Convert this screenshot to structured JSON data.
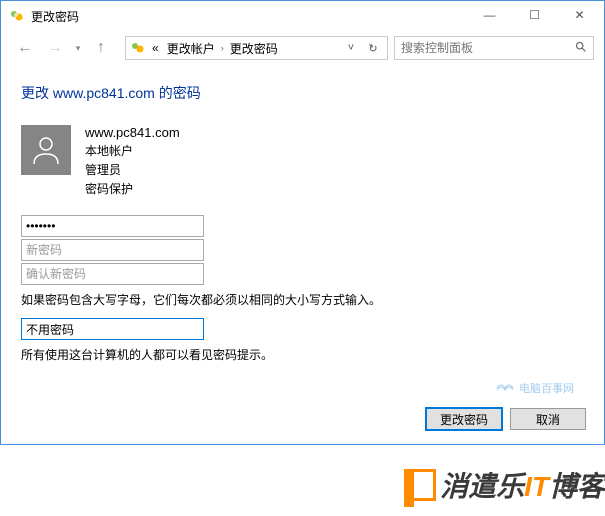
{
  "window": {
    "title": "更改密码",
    "minimize": "—",
    "maximize": "☐",
    "close": "✕"
  },
  "nav": {
    "back": "←",
    "forward": "→",
    "dropdown": "▾",
    "up": "↑",
    "refresh": "↻",
    "addr_dropdown": "˅",
    "breadcrumb": [
      "更改帐户",
      "更改密码"
    ],
    "crumb_prefix": "«",
    "search_placeholder": "搜索控制面板"
  },
  "page": {
    "title": "更改 www.pc841.com 的密码"
  },
  "user": {
    "name": "www.pc841.com",
    "type": "本地帐户",
    "role": "管理员",
    "protection": "密码保护"
  },
  "fields": {
    "current_value": "•••••••",
    "new_placeholder": "新密码",
    "confirm_placeholder": "确认新密码",
    "hint_value": "不用密码"
  },
  "help": {
    "text1": "如果密码包含大写字母，它们每次都必须以相同的大小写方式输入。",
    "text2": "所有使用这台计算机的人都可以看见密码提示。"
  },
  "buttons": {
    "submit": "更改密码",
    "cancel": "取消"
  },
  "watermark": {
    "text": "电脑百事网"
  },
  "logo": {
    "text_main": "消遣乐IT博客"
  }
}
